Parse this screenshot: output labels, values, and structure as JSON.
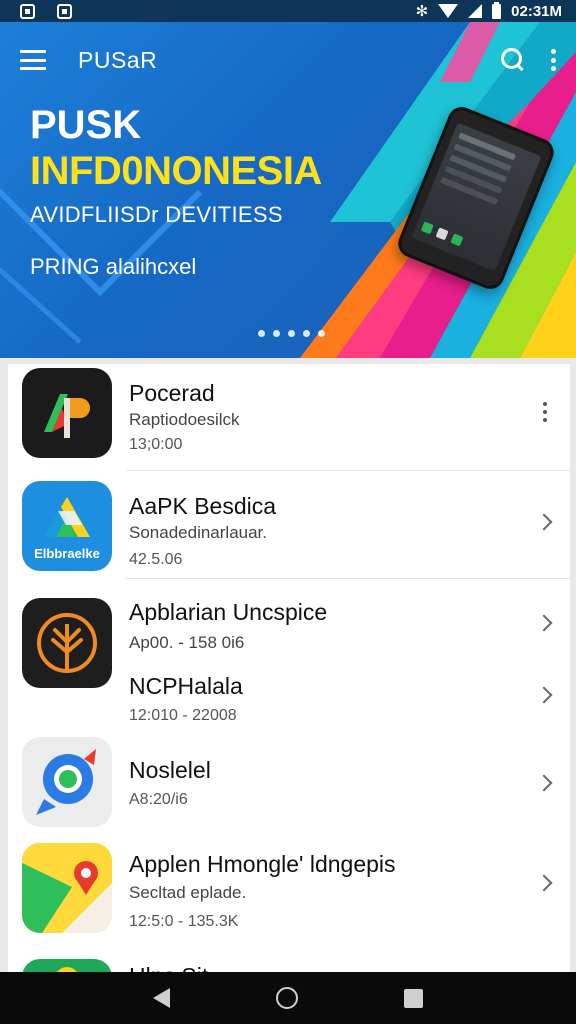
{
  "status_bar": {
    "time": "02:31M"
  },
  "toolbar": {
    "title": "PUSaR",
    "search_icon": "search-icon",
    "more_icon": "more-vert-icon"
  },
  "hero": {
    "title_line1": "PUSK",
    "title_line2": "INFD0NONESIA",
    "subtitle": "AVIDFLIISDr DEVITIESS",
    "tagline": "PRING alalihcxel",
    "carousel_dots": 5,
    "colors": {
      "background": "#1668c4",
      "title_accent": "#ffe019"
    }
  },
  "apps": [
    {
      "title": "Pocerad",
      "subtitle": "Raptiodoesilck",
      "meta": "13;0:00",
      "icon": "ap-logo-icon",
      "action": "more-vert-icon"
    },
    {
      "title": "AaPK Besdica",
      "subtitle": "Sonadedinarlauar.",
      "meta": "42.5.06",
      "icon": "drive-triangle-icon",
      "icon_label": "Elbbraelke",
      "action": "chevron-right-icon"
    },
    {
      "title": "Apblarian Uncspice",
      "subtitle": "Ap00. - 158 0i6",
      "icon": "tree-circle-icon",
      "action": "chevron-right-icon"
    },
    {
      "title": "NCPHalala",
      "meta": "12:010 - 22008",
      "action": "chevron-right-icon"
    },
    {
      "title": "Noslelel",
      "meta": "A8:20/i6",
      "icon": "chrome-swirl-icon",
      "action": "chevron-right-icon"
    },
    {
      "title": "Applen Hmongle' ldngepis",
      "subtitle": "Secltad eplade.",
      "meta": "12:5:0 - 135.3K",
      "icon": "maps-pin-icon",
      "action": "chevron-right-icon"
    },
    {
      "title": "Hlps Sit",
      "icon": "green-app-icon"
    }
  ],
  "nav_bar": {
    "back_icon": "back-triangle-icon",
    "home_icon": "home-circle-icon",
    "recents_icon": "recents-square-icon"
  }
}
